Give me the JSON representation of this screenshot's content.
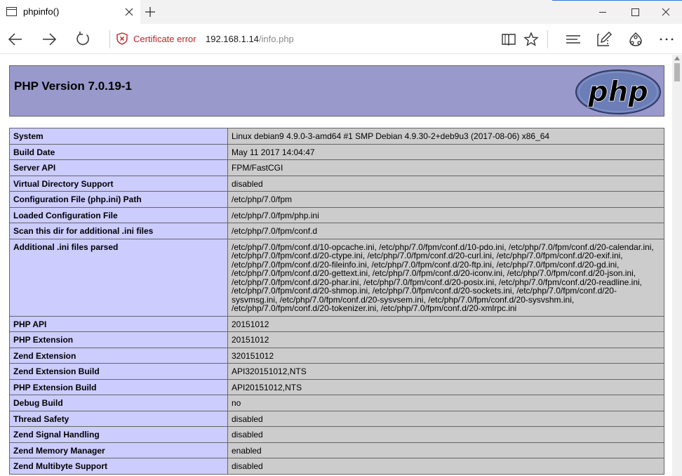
{
  "browser": {
    "tab_title": "phpinfo()",
    "cert_error": "Certificate error",
    "url_host": "192.168.1.14",
    "url_path": "/info.php",
    "accent": "#2b79d8"
  },
  "page": {
    "heading": "PHP Version 7.0.19-1",
    "logo_text": "php",
    "colors": {
      "header_bg": "#9999cc",
      "key_bg": "#ccccff",
      "value_bg": "#cccccc"
    },
    "rows": [
      {
        "key": "System",
        "value": "Linux debian9 4.9.0-3-amd64 #1 SMP Debian 4.9.30-2+deb9u3 (2017-08-06) x86_64"
      },
      {
        "key": "Build Date",
        "value": "May 11 2017 14:04:47"
      },
      {
        "key": "Server API",
        "value": "FPM/FastCGI"
      },
      {
        "key": "Virtual Directory Support",
        "value": "disabled"
      },
      {
        "key": "Configuration File (php.ini) Path",
        "value": "/etc/php/7.0/fpm"
      },
      {
        "key": "Loaded Configuration File",
        "value": "/etc/php/7.0/fpm/php.ini"
      },
      {
        "key": "Scan this dir for additional .ini files",
        "value": "/etc/php/7.0/fpm/conf.d"
      },
      {
        "key": "Additional .ini files parsed",
        "value_lines": [
          "/etc/php/7.0/fpm/conf.d/10-opcache.ini, /etc/php/7.0/fpm/conf.d/10-pdo.ini, /etc/php/7.0/fpm/conf.d/20-calendar.ini,",
          "/etc/php/7.0/fpm/conf.d/20-ctype.ini, /etc/php/7.0/fpm/conf.d/20-curl.ini, /etc/php/7.0/fpm/conf.d/20-exif.ini,",
          "/etc/php/7.0/fpm/conf.d/20-fileinfo.ini, /etc/php/7.0/fpm/conf.d/20-ftp.ini, /etc/php/7.0/fpm/conf.d/20-gd.ini,",
          "/etc/php/7.0/fpm/conf.d/20-gettext.ini, /etc/php/7.0/fpm/conf.d/20-iconv.ini, /etc/php/7.0/fpm/conf.d/20-json.ini,",
          "/etc/php/7.0/fpm/conf.d/20-phar.ini, /etc/php/7.0/fpm/conf.d/20-posix.ini, /etc/php/7.0/fpm/conf.d/20-readline.ini,",
          "/etc/php/7.0/fpm/conf.d/20-shmop.ini, /etc/php/7.0/fpm/conf.d/20-sockets.ini, /etc/php/7.0/fpm/conf.d/20-",
          "sysvmsg.ini, /etc/php/7.0/fpm/conf.d/20-sysvsem.ini, /etc/php/7.0/fpm/conf.d/20-sysvshm.ini,",
          "/etc/php/7.0/fpm/conf.d/20-tokenizer.ini, /etc/php/7.0/fpm/conf.d/20-xmlrpc.ini"
        ]
      },
      {
        "key": "PHP API",
        "value": "20151012"
      },
      {
        "key": "PHP Extension",
        "value": "20151012"
      },
      {
        "key": "Zend Extension",
        "value": "320151012"
      },
      {
        "key": "Zend Extension Build",
        "value": "API320151012,NTS"
      },
      {
        "key": "PHP Extension Build",
        "value": "API20151012,NTS"
      },
      {
        "key": "Debug Build",
        "value": "no"
      },
      {
        "key": "Thread Safety",
        "value": "disabled"
      },
      {
        "key": "Zend Signal Handling",
        "value": "disabled"
      },
      {
        "key": "Zend Memory Manager",
        "value": "enabled"
      },
      {
        "key": "Zend Multibyte Support",
        "value": "disabled"
      }
    ]
  }
}
